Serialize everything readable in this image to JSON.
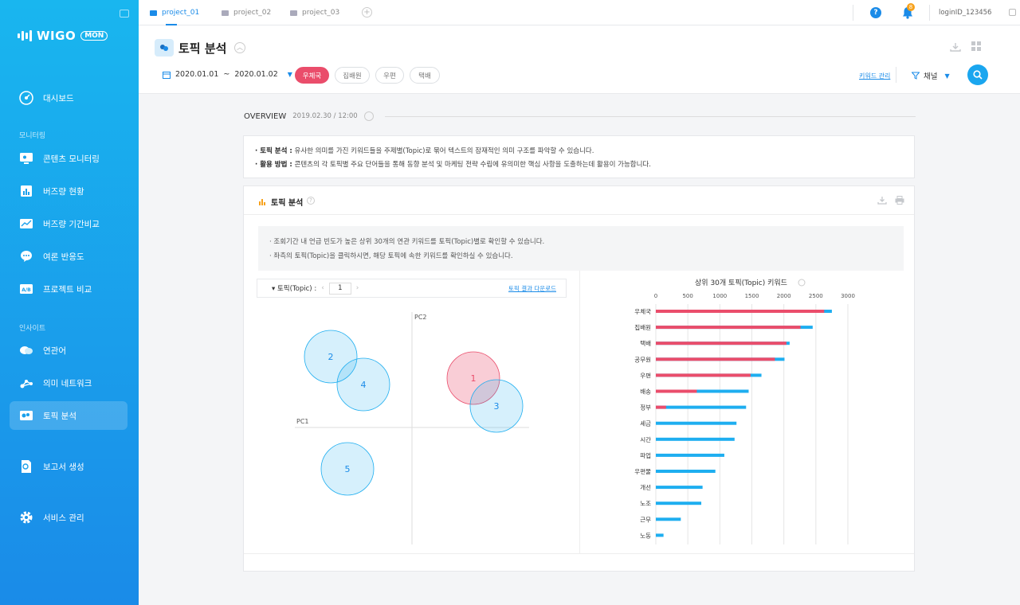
{
  "app": {
    "logo_text": "WIGO",
    "logo_badge": "MON"
  },
  "project_tabs": [
    {
      "label": "project_01",
      "active": true
    },
    {
      "label": "project_02",
      "active": false
    },
    {
      "label": "project_03",
      "active": false
    }
  ],
  "header": {
    "help": "?",
    "notifications_count": "8",
    "login_id": "loginID_123456"
  },
  "sidebar": {
    "items": [
      {
        "label": "대시보드",
        "icon": "dashboard-icon"
      },
      {
        "label": "콘텐츠 모니터링",
        "icon": "monitor-icon"
      },
      {
        "label": "버즈량 현황",
        "icon": "bar-chart-icon"
      },
      {
        "label": "버즈량 기간비교",
        "icon": "compare-icon"
      },
      {
        "label": "여론 반응도",
        "icon": "speech-bubble-icon"
      },
      {
        "label": "프로젝트 비교",
        "icon": "ab-compare-icon"
      },
      {
        "label": "연관어",
        "icon": "related-words-icon"
      },
      {
        "label": "의미 네트워크",
        "icon": "network-icon"
      },
      {
        "label": "토픽 분석",
        "icon": "topic-icon"
      },
      {
        "label": "보고서 생성",
        "icon": "report-icon"
      },
      {
        "label": "서비스 관리",
        "icon": "gear-icon"
      }
    ],
    "sections": {
      "monitoring": "모니터링",
      "insight": "인사이트"
    },
    "active_item": "토픽 분석"
  },
  "page": {
    "title": "토픽 분석",
    "date_start": "2020.01.01",
    "date_sep": "~",
    "date_end": "2020.01.02",
    "chips": [
      "우체국",
      "집배원",
      "우편",
      "택배"
    ],
    "keyword_link": "키워드 관리",
    "channel_label": "채널"
  },
  "overview": {
    "title": "OVERVIEW",
    "date": "2019.02.30 / 12:00",
    "line1_bold": "· 토픽 분석 :",
    "line1": " 유사한 의미를 가진 키워드들을 주제별(Topic)로 묶어 텍스트의 잠재적인 의미 구조를 파악할 수 있습니다.",
    "line2_bold": "· 활용 방법 :",
    "line2": " 콘텐츠의 각 토픽별 주요 단어들을 통해 동향 분석 및 마케팅 전략 수립에 유의미한 핵심 사항을 도출하는데 활용이 가능합니다."
  },
  "topic_card": {
    "title": "토픽 분석",
    "info1": "· 조회기간 내 언급 빈도가 높은 상위 30개의 연관 키워드를 토픽(Topic)별로 확인할 수 있습니다.",
    "info2": "· 좌측의 토픽(Topic)을 클릭하시면, 해당 토픽에 속한 키워드를 확인하실 수 있습니다.",
    "topic_label": "▾ 토픽(Topic) :",
    "page_value": "1",
    "download_link": "토픽 결과 다운로드"
  },
  "colors": {
    "accent": "#1a8be8",
    "pink": "#ea4d6b",
    "blue": "#1eaef0"
  },
  "chart_data": [
    {
      "type": "scatter",
      "title": "",
      "xlabel": "PC1",
      "ylabel": "PC2",
      "points": [
        {
          "label": "1",
          "highlight": true
        },
        {
          "label": "2",
          "highlight": false
        },
        {
          "label": "3",
          "highlight": false
        },
        {
          "label": "4",
          "highlight": false
        },
        {
          "label": "5",
          "highlight": false
        }
      ]
    },
    {
      "type": "bar",
      "title": "상위 30개 토픽(Topic) 키워드",
      "orientation": "horizontal",
      "xlim": [
        0,
        3000
      ],
      "ticks": [
        0,
        500,
        1000,
        1500,
        2000,
        2500,
        3000
      ],
      "categories": [
        "우체국",
        "집배원",
        "택배",
        "공무원",
        "우편",
        "배송",
        "정부",
        "세금",
        "시간",
        "파업",
        "우편물",
        "개선",
        "노조",
        "근무",
        "노동"
      ],
      "series": [
        {
          "color": "#1eaef0",
          "values": [
            2750,
            2450,
            2090,
            2010,
            1650,
            1450,
            1410,
            1260,
            1230,
            1070,
            930,
            730,
            710,
            390,
            120
          ]
        },
        {
          "color": "#ea4d6b",
          "values": [
            2630,
            2260,
            2040,
            1860,
            1480,
            640,
            160,
            0,
            0,
            0,
            0,
            0,
            0,
            0,
            0
          ]
        }
      ]
    }
  ]
}
